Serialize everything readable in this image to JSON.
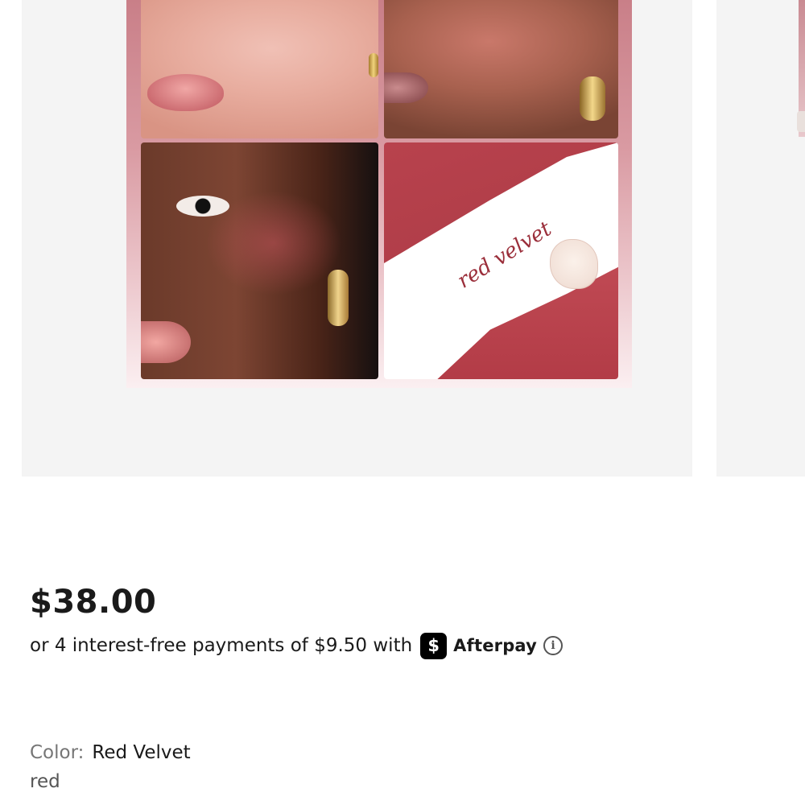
{
  "product_images": {
    "current_slide": {
      "shade_text": "red velvet"
    }
  },
  "pricing": {
    "price": "$38.00",
    "installments_text": "or 4 interest-free payments of $9.50 with",
    "afterpay_badge_glyph": "$",
    "afterpay_name": "Afterpay",
    "info_icon_glyph": "i"
  },
  "color": {
    "label": "Color:",
    "value": "Red Velvet",
    "sub_value": "red"
  }
}
